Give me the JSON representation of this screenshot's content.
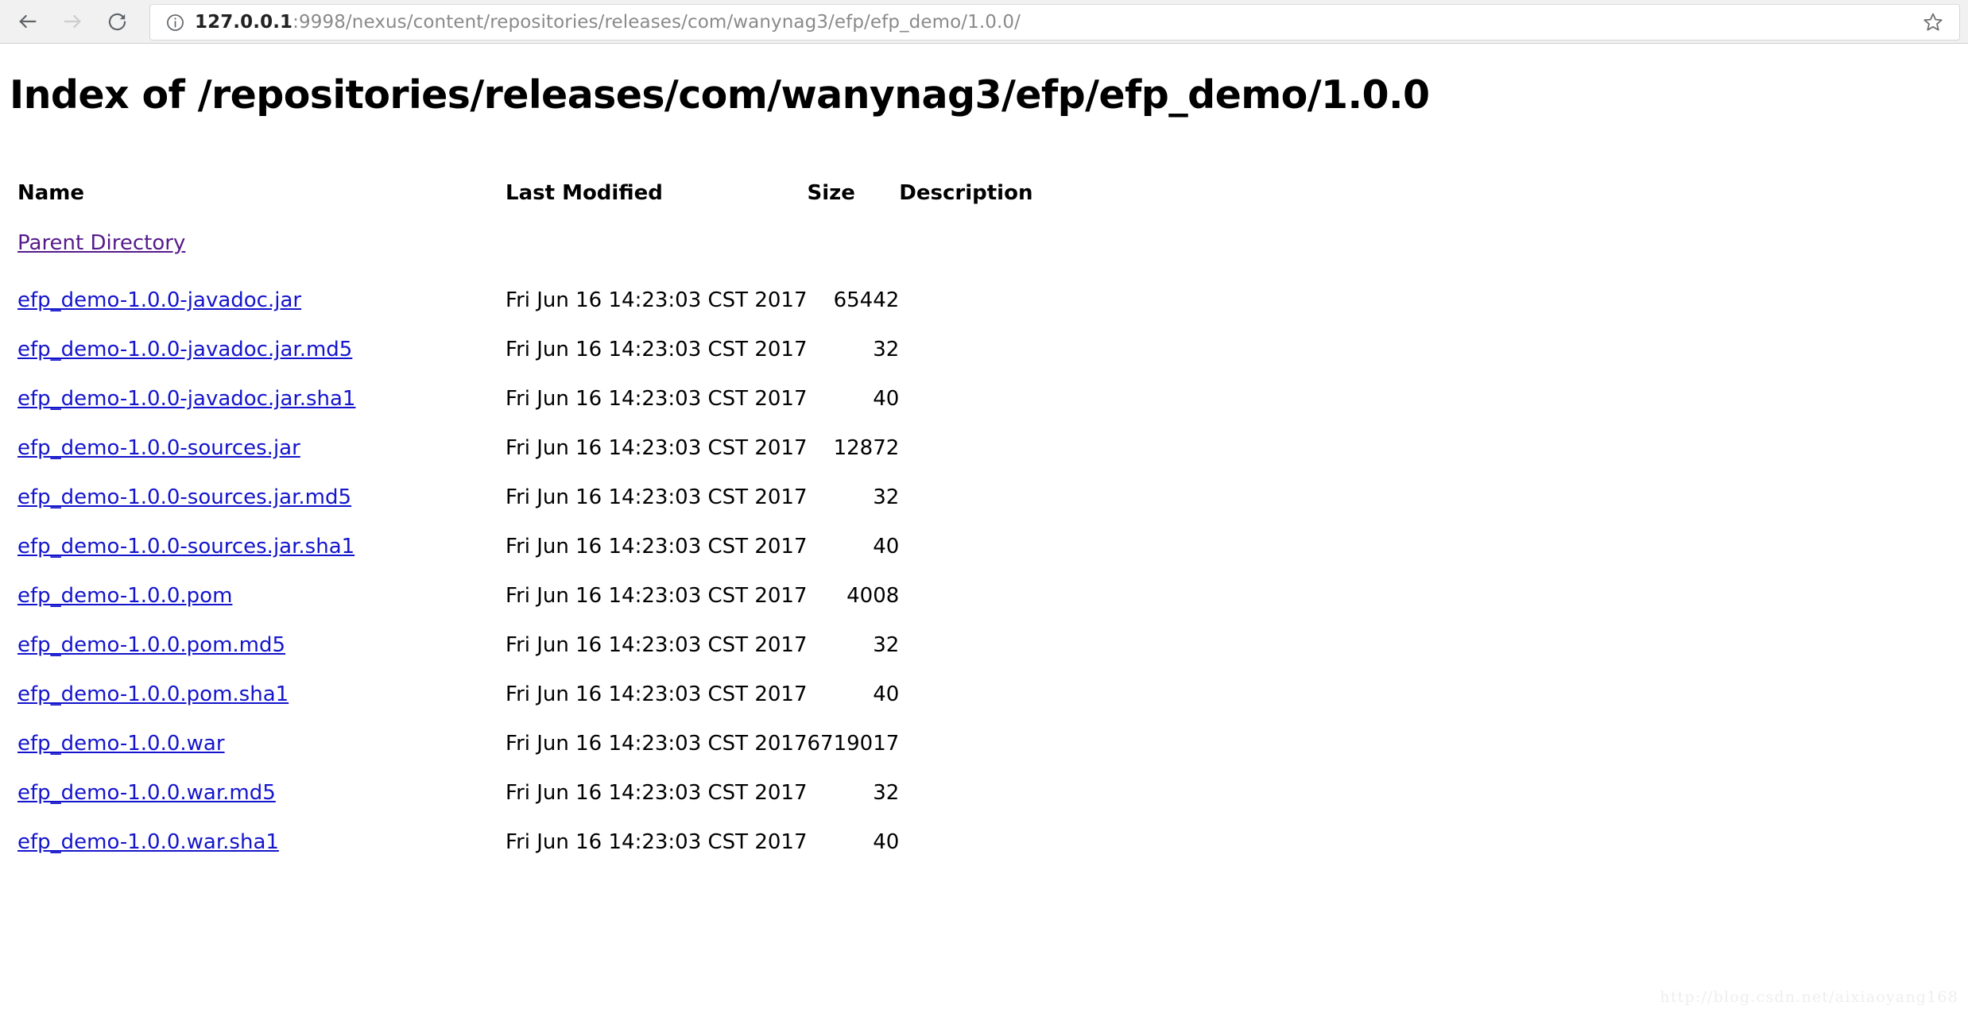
{
  "browser": {
    "back_tooltip": "Back",
    "forward_tooltip": "Forward",
    "reload_tooltip": "Reload this page",
    "info_tooltip": "View site information",
    "bookmark_tooltip": "Bookmark this page",
    "url_host": "127.0.0.1",
    "url_rest": ":9998/nexus/content/repositories/releases/com/wanynag3/efp/efp_demo/1.0.0/",
    "url_full": "127.0.0.1:9998/nexus/content/repositories/releases/com/wanynag3/efp/efp_demo/1.0.0/"
  },
  "page": {
    "title": "Index of /repositories/releases/com/wanynag3/efp/efp_demo/1.0.0",
    "watermark": "http://blog.csdn.net/aixiaoyang168"
  },
  "table": {
    "headers": {
      "name": "Name",
      "last_modified": "Last Modified",
      "size": "Size",
      "description": "Description"
    },
    "parent": {
      "label": "Parent Directory",
      "last_modified": "",
      "size": "",
      "description": ""
    },
    "rows": [
      {
        "name": "efp_demo-1.0.0-javadoc.jar",
        "last_modified": "Fri Jun 16 14:23:03 CST 2017",
        "size": "65442",
        "description": ""
      },
      {
        "name": "efp_demo-1.0.0-javadoc.jar.md5",
        "last_modified": "Fri Jun 16 14:23:03 CST 2017",
        "size": "32",
        "description": ""
      },
      {
        "name": "efp_demo-1.0.0-javadoc.jar.sha1",
        "last_modified": "Fri Jun 16 14:23:03 CST 2017",
        "size": "40",
        "description": ""
      },
      {
        "name": "efp_demo-1.0.0-sources.jar",
        "last_modified": "Fri Jun 16 14:23:03 CST 2017",
        "size": "12872",
        "description": ""
      },
      {
        "name": "efp_demo-1.0.0-sources.jar.md5",
        "last_modified": "Fri Jun 16 14:23:03 CST 2017",
        "size": "32",
        "description": ""
      },
      {
        "name": "efp_demo-1.0.0-sources.jar.sha1",
        "last_modified": "Fri Jun 16 14:23:03 CST 2017",
        "size": "40",
        "description": ""
      },
      {
        "name": "efp_demo-1.0.0.pom",
        "last_modified": "Fri Jun 16 14:23:03 CST 2017",
        "size": "4008",
        "description": ""
      },
      {
        "name": "efp_demo-1.0.0.pom.md5",
        "last_modified": "Fri Jun 16 14:23:03 CST 2017",
        "size": "32",
        "description": ""
      },
      {
        "name": "efp_demo-1.0.0.pom.sha1",
        "last_modified": "Fri Jun 16 14:23:03 CST 2017",
        "size": "40",
        "description": ""
      },
      {
        "name": "efp_demo-1.0.0.war",
        "last_modified": "Fri Jun 16 14:23:03 CST 2017",
        "size": "6719017",
        "description": ""
      },
      {
        "name": "efp_demo-1.0.0.war.md5",
        "last_modified": "Fri Jun 16 14:23:03 CST 2017",
        "size": "32",
        "description": ""
      },
      {
        "name": "efp_demo-1.0.0.war.sha1",
        "last_modified": "Fri Jun 16 14:23:03 CST 2017",
        "size": "40",
        "description": ""
      }
    ]
  },
  "colors": {
    "link": "#1414cc",
    "visited_link": "#551a8b",
    "chrome_bg": "#f1f1f1",
    "text": "#000000",
    "url_gray": "#8a8a8a"
  },
  "icons": {
    "back": "arrow-left-icon",
    "forward": "arrow-right-icon",
    "reload": "reload-icon",
    "info": "info-circle-icon",
    "bookmark": "star-outline-icon"
  }
}
